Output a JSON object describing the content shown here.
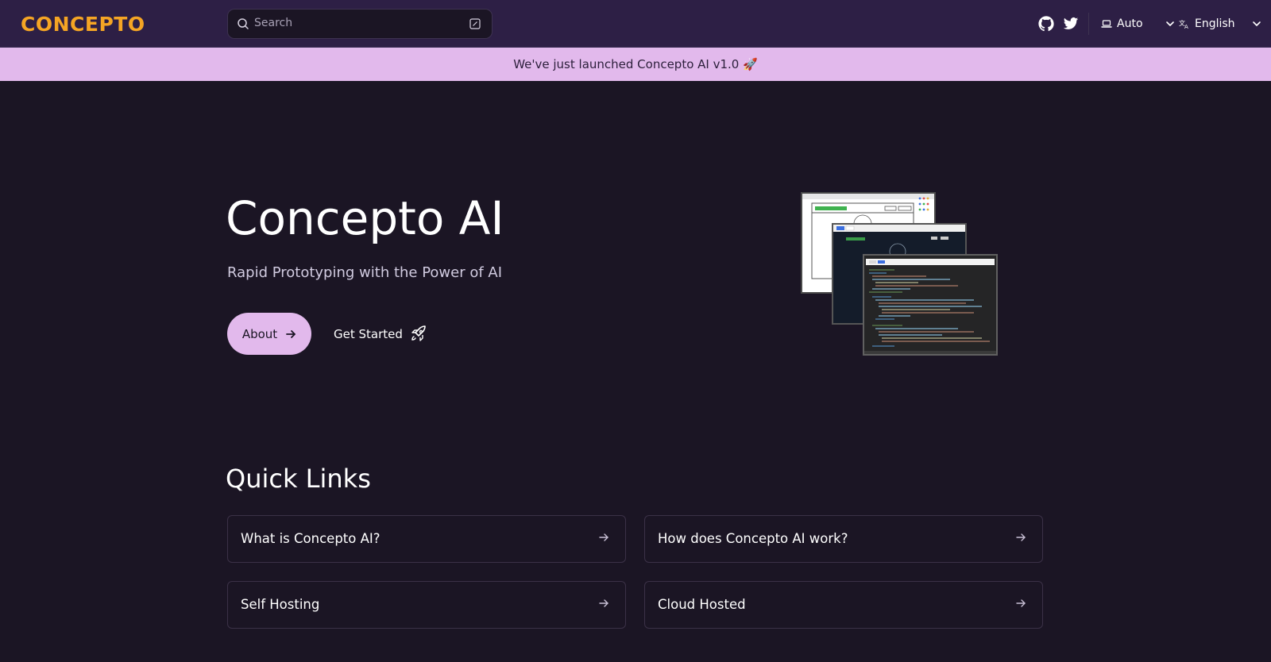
{
  "header": {
    "logo_text": "CONCEPTO",
    "search_placeholder": "Search",
    "theme": {
      "label": "Auto"
    },
    "language": {
      "label": "English"
    },
    "icons": [
      "github-icon",
      "twitter-icon",
      "laptop-icon",
      "translate-icon"
    ]
  },
  "banner": {
    "text": "We've just launched Concepto AI v1.0 🚀"
  },
  "hero": {
    "title": "Concepto AI",
    "subtitle": "Rapid Prototyping with the Power of AI",
    "about_label": "About",
    "get_started_label": "Get Started"
  },
  "quick_links": {
    "title": "Quick Links",
    "items": [
      {
        "label": "What is Concepto AI?"
      },
      {
        "label": "How does Concepto AI work?"
      },
      {
        "label": "Self Hosting"
      },
      {
        "label": "Cloud Hosted"
      }
    ]
  },
  "colors": {
    "background": "#1b1524",
    "header_bg": "#2d1f45",
    "accent": "#e2b9ec",
    "logo": "#f5a524"
  }
}
